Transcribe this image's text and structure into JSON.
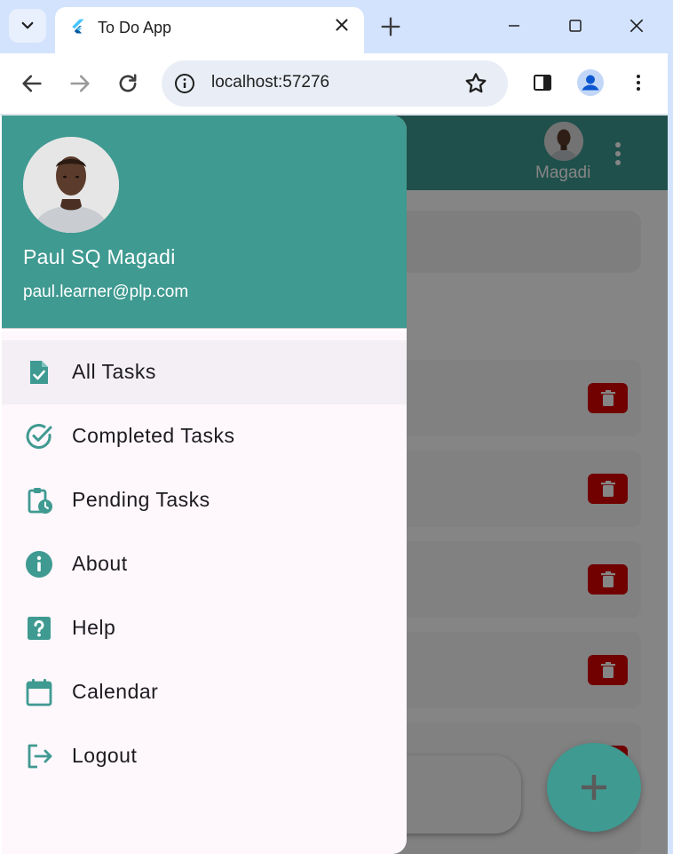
{
  "browser": {
    "tab_title": "To Do App",
    "url": "localhost:57276"
  },
  "app": {
    "appbar": {
      "user_short_name": "Magadi",
      "color": "#3f9a91"
    },
    "task_cards_count_visible": 5,
    "delete_button_color": "#d80000",
    "fab_label": "+"
  },
  "drawer": {
    "header": {
      "name": "Paul SQ Magadi",
      "email": "paul.learner@plp.com",
      "color": "#3f9a91"
    },
    "items": [
      {
        "label": "All Tasks",
        "icon": "task-file-icon",
        "selected": true
      },
      {
        "label": "Completed Tasks",
        "icon": "check-circle-icon",
        "selected": false
      },
      {
        "label": "Pending Tasks",
        "icon": "clipboard-clock-icon",
        "selected": false
      },
      {
        "label": "About",
        "icon": "info-icon",
        "selected": false
      },
      {
        "label": "Help",
        "icon": "help-icon",
        "selected": false
      },
      {
        "label": "Calendar",
        "icon": "calendar-icon",
        "selected": false
      },
      {
        "label": "Logout",
        "icon": "logout-icon",
        "selected": false
      }
    ]
  }
}
